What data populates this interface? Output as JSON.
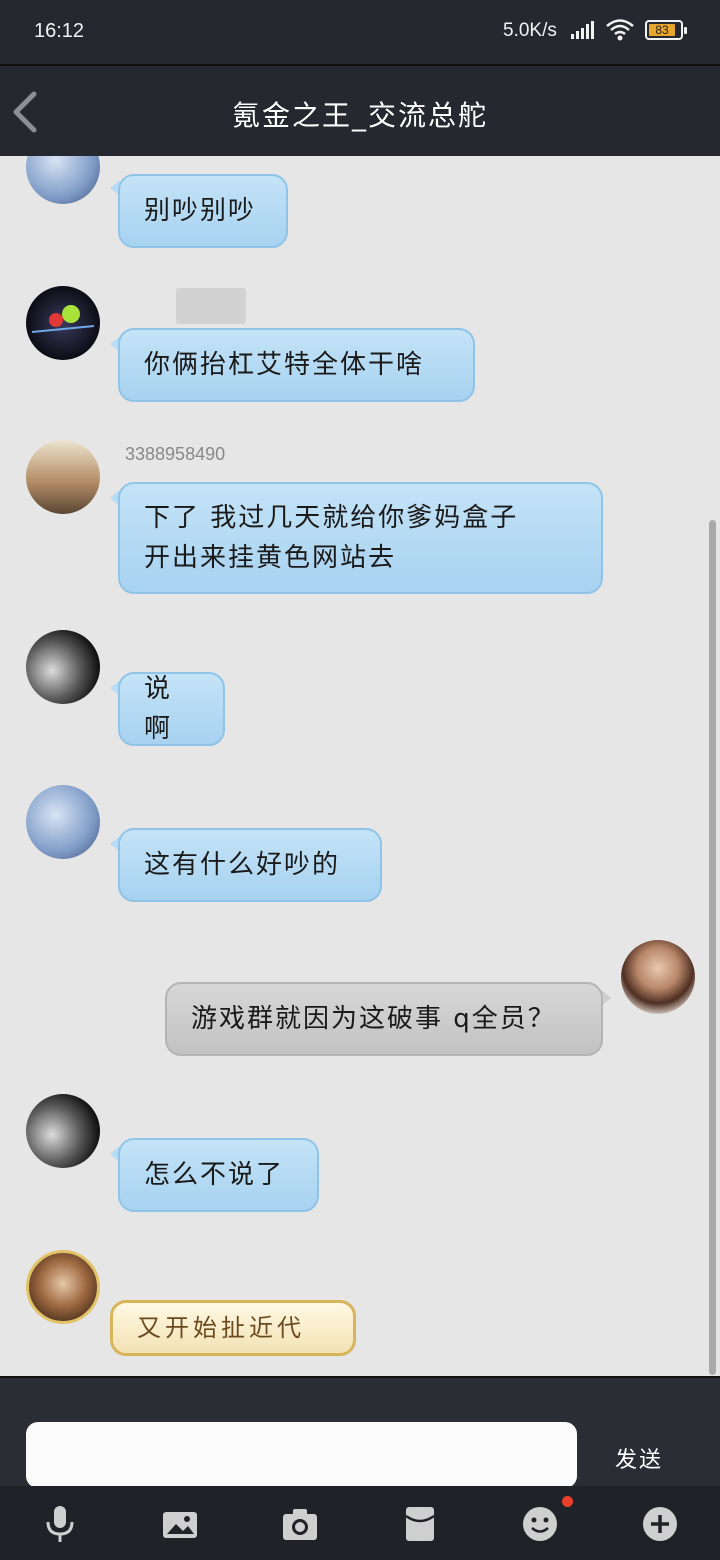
{
  "status_bar": {
    "time": "16:12",
    "net_speed": "5.0K/s",
    "battery": "83"
  },
  "header": {
    "title": "氪金之王_交流总舵"
  },
  "messages": [
    {
      "sender": "",
      "text": "别吵别吵",
      "side": "left"
    },
    {
      "sender": "",
      "text": "你俩抬杠艾特全体干啥",
      "side": "left"
    },
    {
      "sender": "3388958490",
      "lines": [
        "下了 我过几天就给你爹妈盒子",
        "开出来挂黄色网站去"
      ],
      "side": "left"
    },
    {
      "sender": "",
      "text": "说啊",
      "side": "left"
    },
    {
      "sender": "",
      "text": "这有什么好吵的",
      "side": "left"
    },
    {
      "sender": "",
      "text": "游戏群就因为这破事 q全员？",
      "side": "right"
    },
    {
      "sender": "",
      "text": "怎么不说了",
      "side": "left"
    },
    {
      "sender": "",
      "text": "又开始扯近代",
      "side": "left"
    }
  ],
  "input": {
    "value": "",
    "placeholder": "",
    "send_label": "发送"
  },
  "toolbar": {
    "icons": [
      "microphone-icon",
      "image-icon",
      "camera-icon",
      "red-packet-icon",
      "emoji-icon",
      "plus-icon"
    ]
  },
  "colors": {
    "header_bg": "#25282f",
    "bubble_blue": "#b3d9f3",
    "bubble_gray": "#c9c9c9",
    "chat_bg": "#e6e6e6",
    "badge": "#e8402a"
  }
}
